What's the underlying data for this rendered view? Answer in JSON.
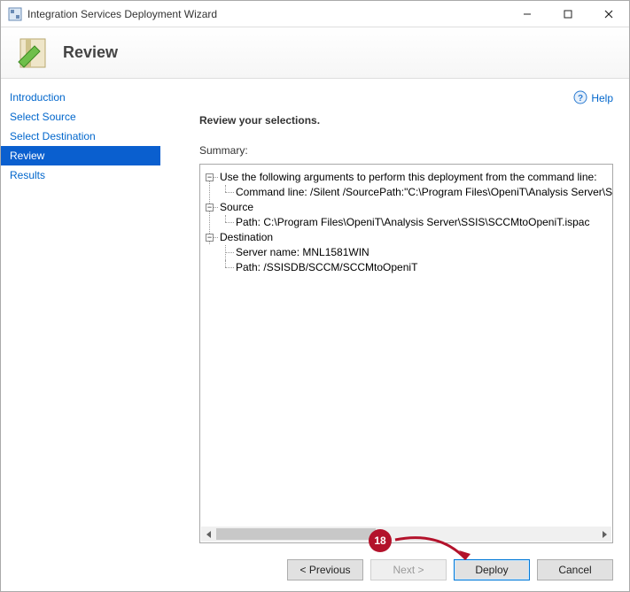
{
  "window": {
    "title": "Integration Services Deployment Wizard"
  },
  "header": {
    "title": "Review"
  },
  "sidebar": {
    "items": [
      {
        "label": "Introduction"
      },
      {
        "label": "Select Source"
      },
      {
        "label": "Select Destination"
      },
      {
        "label": "Review"
      },
      {
        "label": "Results"
      }
    ],
    "selected_index": 3
  },
  "help": {
    "label": "Help"
  },
  "main": {
    "heading": "Review your selections.",
    "summary_label": "Summary:",
    "tree": {
      "cmdline_heading": "Use the following arguments to perform this deployment from the command line:",
      "cmdline_value": "Command line: /Silent /SourcePath:\"C:\\Program Files\\OpeniT\\Analysis Server\\SSIS\\SCCM",
      "source_heading": "Source",
      "source_path": "Path: C:\\Program Files\\OpeniT\\Analysis Server\\SSIS\\SCCMtoOpeniT.ispac",
      "dest_heading": "Destination",
      "dest_server": "Server name: MNL1581WIN",
      "dest_path": "Path: /SSISDB/SCCM/SCCMtoOpeniT"
    }
  },
  "buttons": {
    "previous": "< Previous",
    "next": "Next >",
    "deploy": "Deploy",
    "cancel": "Cancel"
  },
  "annotation": {
    "badge": "18"
  }
}
